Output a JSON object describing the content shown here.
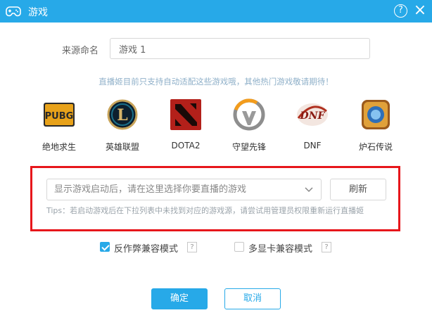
{
  "window": {
    "title": "游戏",
    "help_label": "?",
    "close_label": "×"
  },
  "source": {
    "label": "来源命名",
    "value": "游戏 1"
  },
  "notice": "直播姬目前只支持自动适配这些游戏哦，其他热门游戏敬请期待！",
  "games": [
    {
      "label": "绝地求生",
      "logo_text": "PUBG",
      "icon": "pubg-logo"
    },
    {
      "label": "英雄联盟",
      "logo_text": "L",
      "icon": "lol-logo"
    },
    {
      "label": "DOTA2",
      "icon": "dota2-logo"
    },
    {
      "label": "守望先锋",
      "icon": "overwatch-logo"
    },
    {
      "label": "DNF",
      "logo_text": "DNF",
      "icon": "dnf-logo"
    },
    {
      "label": "炉石传说",
      "icon": "hearthstone-logo"
    }
  ],
  "game_select": {
    "placeholder": "显示游戏启动后，请在这里选择你要直播的游戏"
  },
  "refresh_label": "刷新",
  "tips": "Tips：若启动游戏后在下拉列表中未找到对应的游戏源，请尝试用管理员权限重新运行直播姬",
  "options": [
    {
      "label": "反作弊兼容模式",
      "checked": true,
      "help": "?"
    },
    {
      "label": "多显卡兼容模式",
      "checked": false,
      "help": "?"
    }
  ],
  "buttons": {
    "ok": "确定",
    "cancel": "取消"
  },
  "colors": {
    "accent": "#27a9e8",
    "highlight_frame": "#e7161b"
  }
}
